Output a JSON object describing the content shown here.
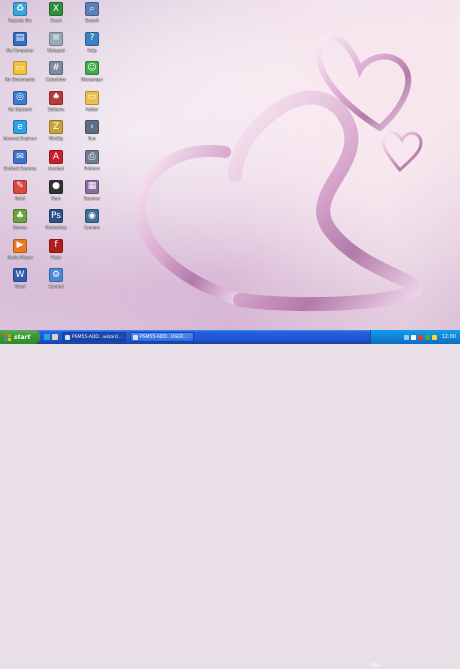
{
  "desktop": {
    "icons": [
      {
        "label": "Recycle Bin",
        "color": "#3aa6d8",
        "glyph": "♻"
      },
      {
        "label": "My Computer",
        "color": "#2f6fc4",
        "glyph": "▤"
      },
      {
        "label": "My Documents",
        "color": "#f2c23a",
        "glyph": "▭"
      },
      {
        "label": "My Network",
        "color": "#3b7bd1",
        "glyph": "◎"
      },
      {
        "label": "Internet Explorer",
        "color": "#2aa3e6",
        "glyph": "e"
      },
      {
        "label": "Outlook Express",
        "color": "#3f73c9",
        "glyph": "✉"
      },
      {
        "label": "Paint",
        "color": "#d84a3c",
        "glyph": "✎"
      },
      {
        "label": "Games",
        "color": "#6aa23d",
        "glyph": "♣"
      },
      {
        "label": "Media Player",
        "color": "#e87a21",
        "glyph": "▶"
      },
      {
        "label": "Word",
        "color": "#2c5fb3",
        "glyph": "W"
      },
      {
        "label": "Excel",
        "color": "#2f8f3c",
        "glyph": "X"
      },
      {
        "label": "Notepad",
        "color": "#9aa7b8",
        "glyph": "≡"
      },
      {
        "label": "Calculator",
        "color": "#7d8aa0",
        "glyph": "#"
      },
      {
        "label": "Solitaire",
        "color": "#b83a3a",
        "glyph": "♠"
      },
      {
        "label": "WinZip",
        "color": "#c9a33a",
        "glyph": "Z"
      },
      {
        "label": "Acrobat",
        "color": "#c8202a",
        "glyph": "A"
      },
      {
        "label": "Nero",
        "color": "#333333",
        "glyph": "●"
      },
      {
        "label": "Photoshop",
        "color": "#2d4f8a",
        "glyph": "Ps"
      },
      {
        "label": "Flash",
        "color": "#b21d1d",
        "glyph": "f"
      },
      {
        "label": "Control",
        "color": "#4a8ad4",
        "glyph": "⚙"
      },
      {
        "label": "Search",
        "color": "#5b7fb8",
        "glyph": "⌕"
      },
      {
        "label": "Help",
        "color": "#3b82c4",
        "glyph": "?"
      },
      {
        "label": "Messenger",
        "color": "#3fae47",
        "glyph": "☺"
      },
      {
        "label": "Folder",
        "color": "#e8c24e",
        "glyph": "▭"
      },
      {
        "label": "Run",
        "color": "#5d6d85",
        "glyph": "›"
      },
      {
        "label": "Printers",
        "color": "#6f7d90",
        "glyph": "⎙"
      },
      {
        "label": "Scanner",
        "color": "#8a6f9e",
        "glyph": "▦"
      },
      {
        "label": "Camera",
        "color": "#3d6f9a",
        "glyph": "◉"
      }
    ]
  },
  "taskbar": {
    "start_label": "start",
    "tasks": [
      {
        "label": "PSM55-ADD...wizard..."
      },
      {
        "label": "PSM55-ADD...USER..."
      }
    ],
    "lang": "EN",
    "clock": "12:00"
  }
}
